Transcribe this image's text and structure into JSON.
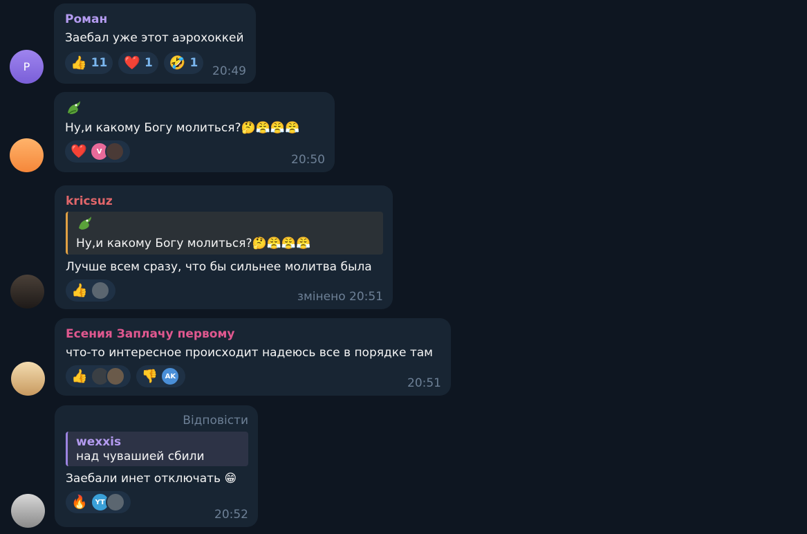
{
  "messages": [
    {
      "sender": "Роман",
      "avatar_letter": "Р",
      "text": "Заебал уже этот аэрохоккей",
      "reactions": [
        {
          "emoji": "👍",
          "count": "11"
        },
        {
          "emoji": "❤️",
          "count": "1"
        },
        {
          "emoji": "🤣",
          "count": "1"
        }
      ],
      "time": "20:49"
    },
    {
      "text": "Ну,и какому Богу молиться?🤔😤😤😤",
      "reactions": [
        {
          "emoji": "❤️",
          "mini_label": "V"
        }
      ],
      "time": "20:50"
    },
    {
      "sender": "kricsuz",
      "quote_text": "Ну,и какому Богу молиться?🤔😤😤😤",
      "text": "Лучше всем сразу, что бы сильнее молитва была",
      "reactions": [
        {
          "emoji": "👍"
        }
      ],
      "time": "змінено 20:51"
    },
    {
      "sender": "Есения Заплачу первому",
      "text": "что-то интересное происходит надеюсь все в порядке там",
      "reactions": [
        {
          "emoji": "👍"
        },
        {
          "emoji": "👎",
          "mini_label": "AK"
        }
      ],
      "time": "20:51"
    },
    {
      "reply_label": "Відповісти",
      "quote_sender": "wexxis",
      "quote_text": "над чувашией сбили",
      "text": "Заебали инет отключать 😁",
      "reactions": [
        {
          "emoji": "🔥",
          "mini_label": "YT"
        }
      ],
      "time": "20:52"
    }
  ],
  "colors": {
    "background": "#0e1621",
    "bubble": "#182533",
    "roman": "#b49bf0",
    "kricsuz": "#e0666a",
    "esenia": "#e0588f"
  }
}
